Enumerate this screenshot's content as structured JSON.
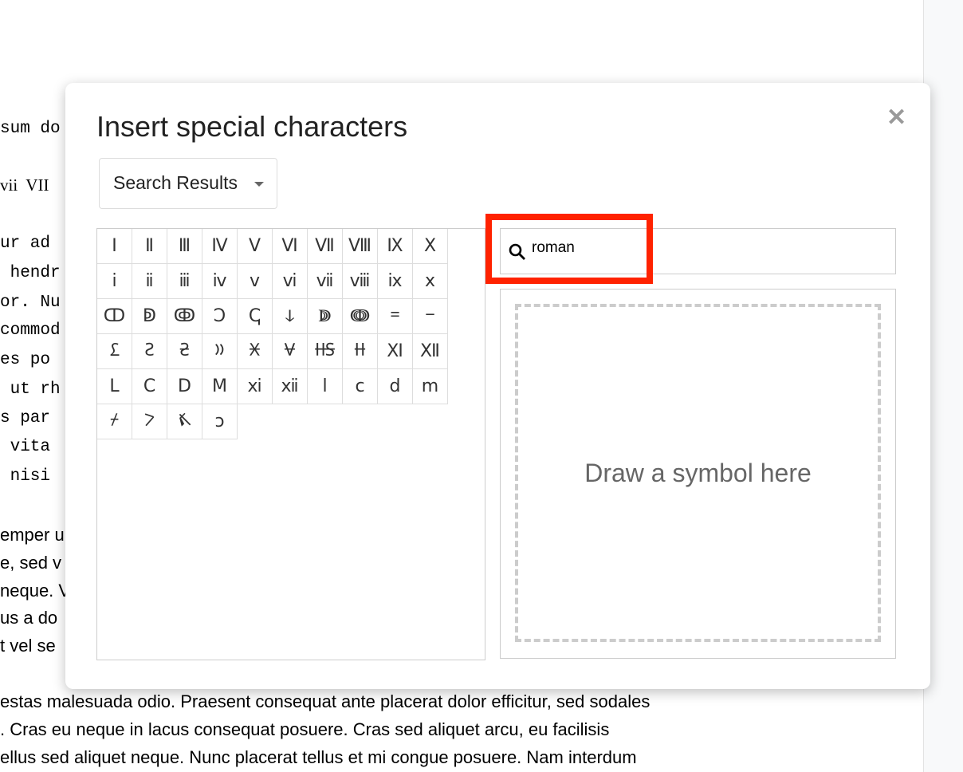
{
  "document": {
    "mono_lines": [
      "sum do",
      "",
      "ur ad",
      " hendr",
      "or. Nu",
      "commod",
      "es po",
      " ut rh",
      "s par",
      " vita",
      " nisi"
    ],
    "serif_line": "vii  VII",
    "sans_lines": [
      "emper u",
      "e, sed v",
      "neque. V",
      "us a do",
      "t vel se"
    ],
    "bottom_lines": [
      "estas malesuada odio. Praesent consequat ante placerat dolor efficitur, sed sodales",
      ". Cras eu neque in lacus consequat posuere. Cras sed aliquet arcu, eu facilisis",
      "ellus sed aliquet neque. Nunc placerat tellus et mi congue posuere. Nam interdum"
    ]
  },
  "dialog": {
    "title": "Insert special characters",
    "close_icon": "close-icon",
    "category_dropdown": "Search Results",
    "search": {
      "value": "roman",
      "icon": "search-icon"
    },
    "draw_placeholder": "Draw a symbol here",
    "highlight_color": "#ff2200",
    "characters": [
      "Ⅰ",
      "Ⅱ",
      "Ⅲ",
      "Ⅳ",
      "Ⅴ",
      "Ⅵ",
      "Ⅶ",
      "Ⅷ",
      "Ⅸ",
      "Ⅹ",
      "ⅰ",
      "ⅱ",
      "ⅲ",
      "ⅳ",
      "ⅴ",
      "ⅵ",
      "ⅶ",
      "ⅷ",
      "ⅸ",
      "ⅹ",
      "ↀ",
      "ↁ",
      "ↂ",
      "Ↄ",
      "ↅ",
      "ↆ",
      "ↇ",
      "ↈ",
      "𐆐",
      "𐆑",
      "𐆒",
      "𐆓",
      "𐆔",
      "𐆕",
      "𐆖",
      "𐆗",
      "𐆘",
      "𐆙",
      "Ⅺ",
      "Ⅻ",
      "Ⅼ",
      "Ⅽ",
      "Ⅾ",
      "Ⅿ",
      "ⅺ",
      "ⅻ",
      "ⅼ",
      "ⅽ",
      "ⅾ",
      "ⅿ",
      "𐆚",
      "𐆛",
      "𐆜",
      "ↄ"
    ]
  }
}
